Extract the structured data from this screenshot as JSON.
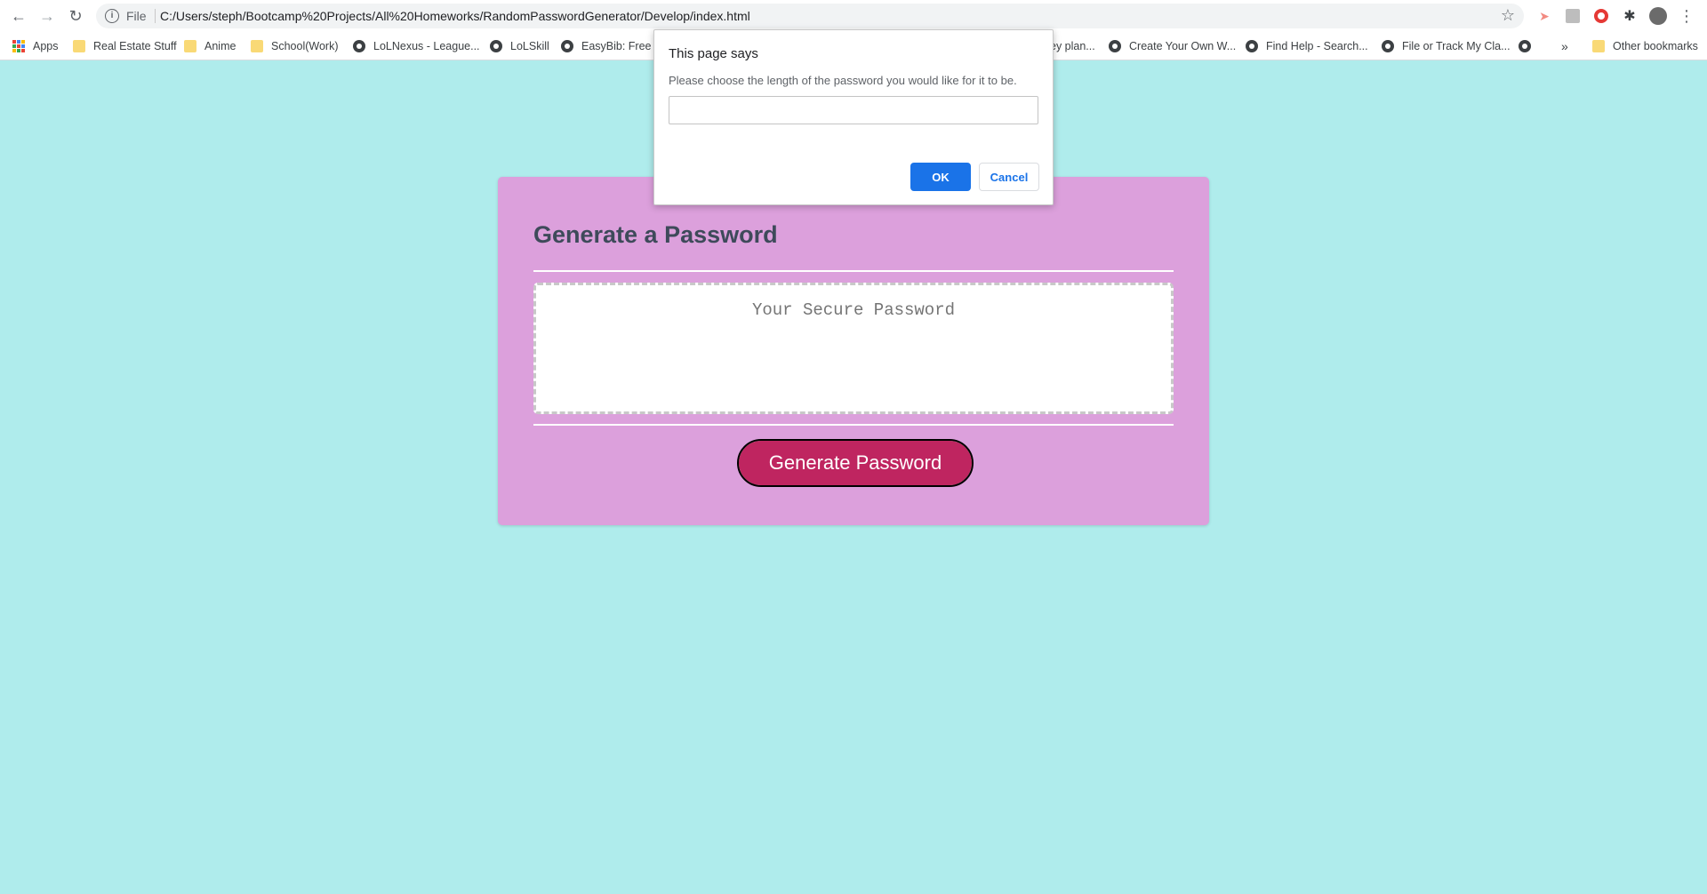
{
  "browser": {
    "url_scheme": "File",
    "url": "C:/Users/steph/Bootcamp%20Projects/All%20Homeworks/RandomPasswordGenerator/Develop/index.html",
    "bookmarks": [
      {
        "label": "Apps",
        "icon": "apps-grid-icon"
      },
      {
        "label": "Real Estate Stuff",
        "icon": "folder-icon"
      },
      {
        "label": "Anime",
        "icon": "folder-icon"
      },
      {
        "label": "School(Work)",
        "icon": "folder-icon"
      },
      {
        "label": "LoLNexus - League...",
        "icon": "globe-icon"
      },
      {
        "label": "LoLSkill",
        "icon": "globe-icon"
      },
      {
        "label": "EasyBib: Free Bi",
        "icon": "globe-icon"
      },
      {
        "label": "ey plan...",
        "icon": "none"
      },
      {
        "label": "Create Your Own W...",
        "icon": "globe-icon"
      },
      {
        "label": "Find Help - Search...",
        "icon": "globe-icon"
      },
      {
        "label": "File or Track My Cla...",
        "icon": "globe-icon"
      }
    ],
    "overflow_label": "»",
    "other_bookmarks": "Other bookmarks"
  },
  "page": {
    "title": "Generate a Password",
    "password_placeholder": "Your Secure Password",
    "generate_button": "Generate Password",
    "colors": {
      "background": "#afecec",
      "card": "#dca0dc",
      "button": "#bf2560"
    }
  },
  "dialog": {
    "title": "This page says",
    "message": "Please choose the length of the password you would like for it to be.",
    "input_value": "",
    "ok_label": "OK",
    "cancel_label": "Cancel"
  }
}
